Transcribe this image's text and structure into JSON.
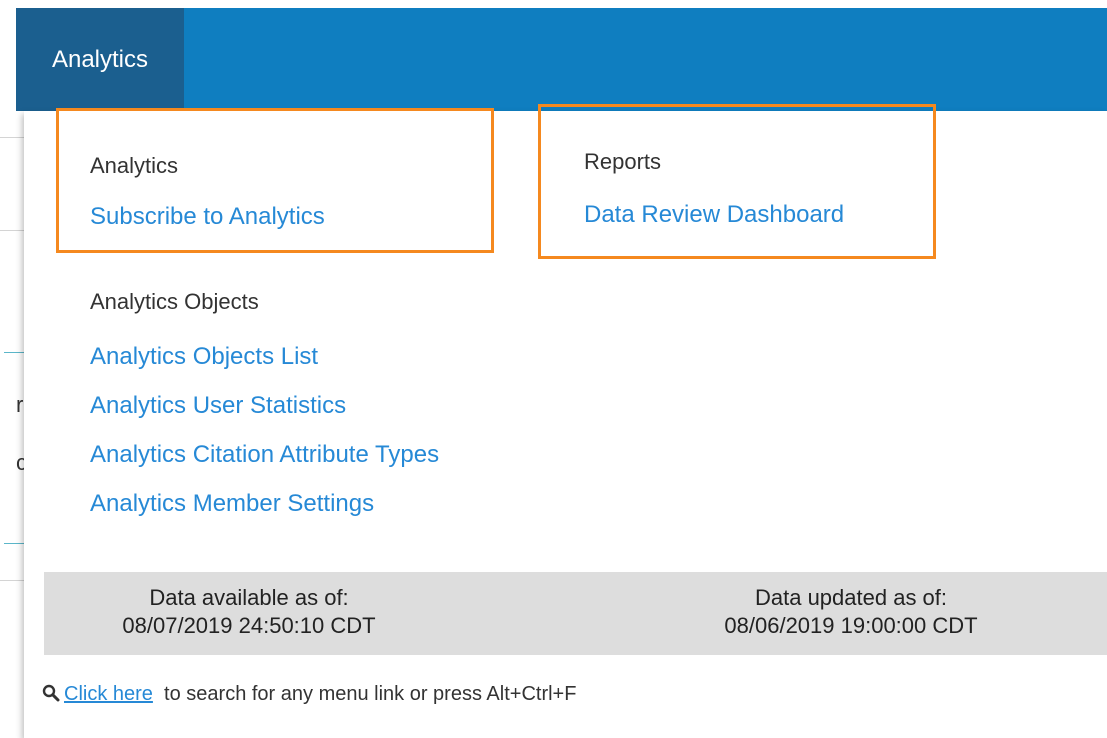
{
  "topbar": {
    "active_tab": "Analytics"
  },
  "sections": {
    "analytics": {
      "heading": "Analytics",
      "links": [
        "Subscribe to Analytics"
      ]
    },
    "reports": {
      "heading": "Reports",
      "links": [
        "Data Review Dashboard"
      ]
    },
    "objects": {
      "heading": "Analytics Objects",
      "links": [
        "Analytics Objects List",
        "Analytics User Statistics",
        "Analytics Citation Attribute Types",
        "Analytics Member Settings"
      ]
    }
  },
  "status": {
    "available_label": "Data available as of:",
    "available_value": "08/07/2019 24:50:10 CDT",
    "updated_label": "Data updated as of:",
    "updated_value": "08/06/2019 19:00:00 CDT"
  },
  "search_hint": {
    "icon": "search-icon",
    "link_text": "Click here",
    "text": "to search for any menu link or press Alt+Ctrl+F"
  },
  "colors": {
    "topbar": "#0f7ec0",
    "active_tab": "#1b5f8f",
    "link": "#2689d6",
    "highlight": "#f5891f",
    "status_bg": "#dddddd"
  },
  "underlay": {
    "glyphs": [
      "r",
      "c"
    ]
  }
}
